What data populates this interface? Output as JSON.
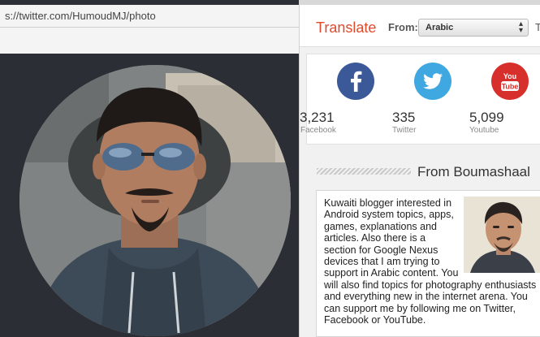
{
  "browser": {
    "url": "s://twitter.com/HumoudMJ/photo"
  },
  "translate": {
    "title": "Translate",
    "from_label": "From:",
    "selected_language": "Arabic",
    "trailing_letter": "T"
  },
  "social": [
    {
      "network": "Facebook",
      "count": "3,231",
      "label": "Facebook",
      "icon": "facebook-icon",
      "color": "#3b5999"
    },
    {
      "network": "Twitter",
      "count": "335",
      "label": "Twitter",
      "icon": "twitter-icon",
      "color": "#40a8e0"
    },
    {
      "network": "Youtube",
      "count": "5,099",
      "label": "Youtube",
      "icon": "youtube-icon",
      "color": "#d72f2b"
    }
  ],
  "youtube_badge": {
    "line1": "You",
    "line2": "Tube"
  },
  "about": {
    "header": "From Boumashaal",
    "text": "Kuwaiti blogger interested in Android system topics, apps, games, explanations and articles. Also there is a section for Google Nexus devices that I am trying to support in Arabic content. You will also find topics for photography enthusiasts and everything new in the internet arena. You can support me by following me on Twitter, Facebook or YouTube."
  },
  "colors": {
    "accent": "#e04a2c",
    "dark_overlay": "#2b2e34"
  }
}
